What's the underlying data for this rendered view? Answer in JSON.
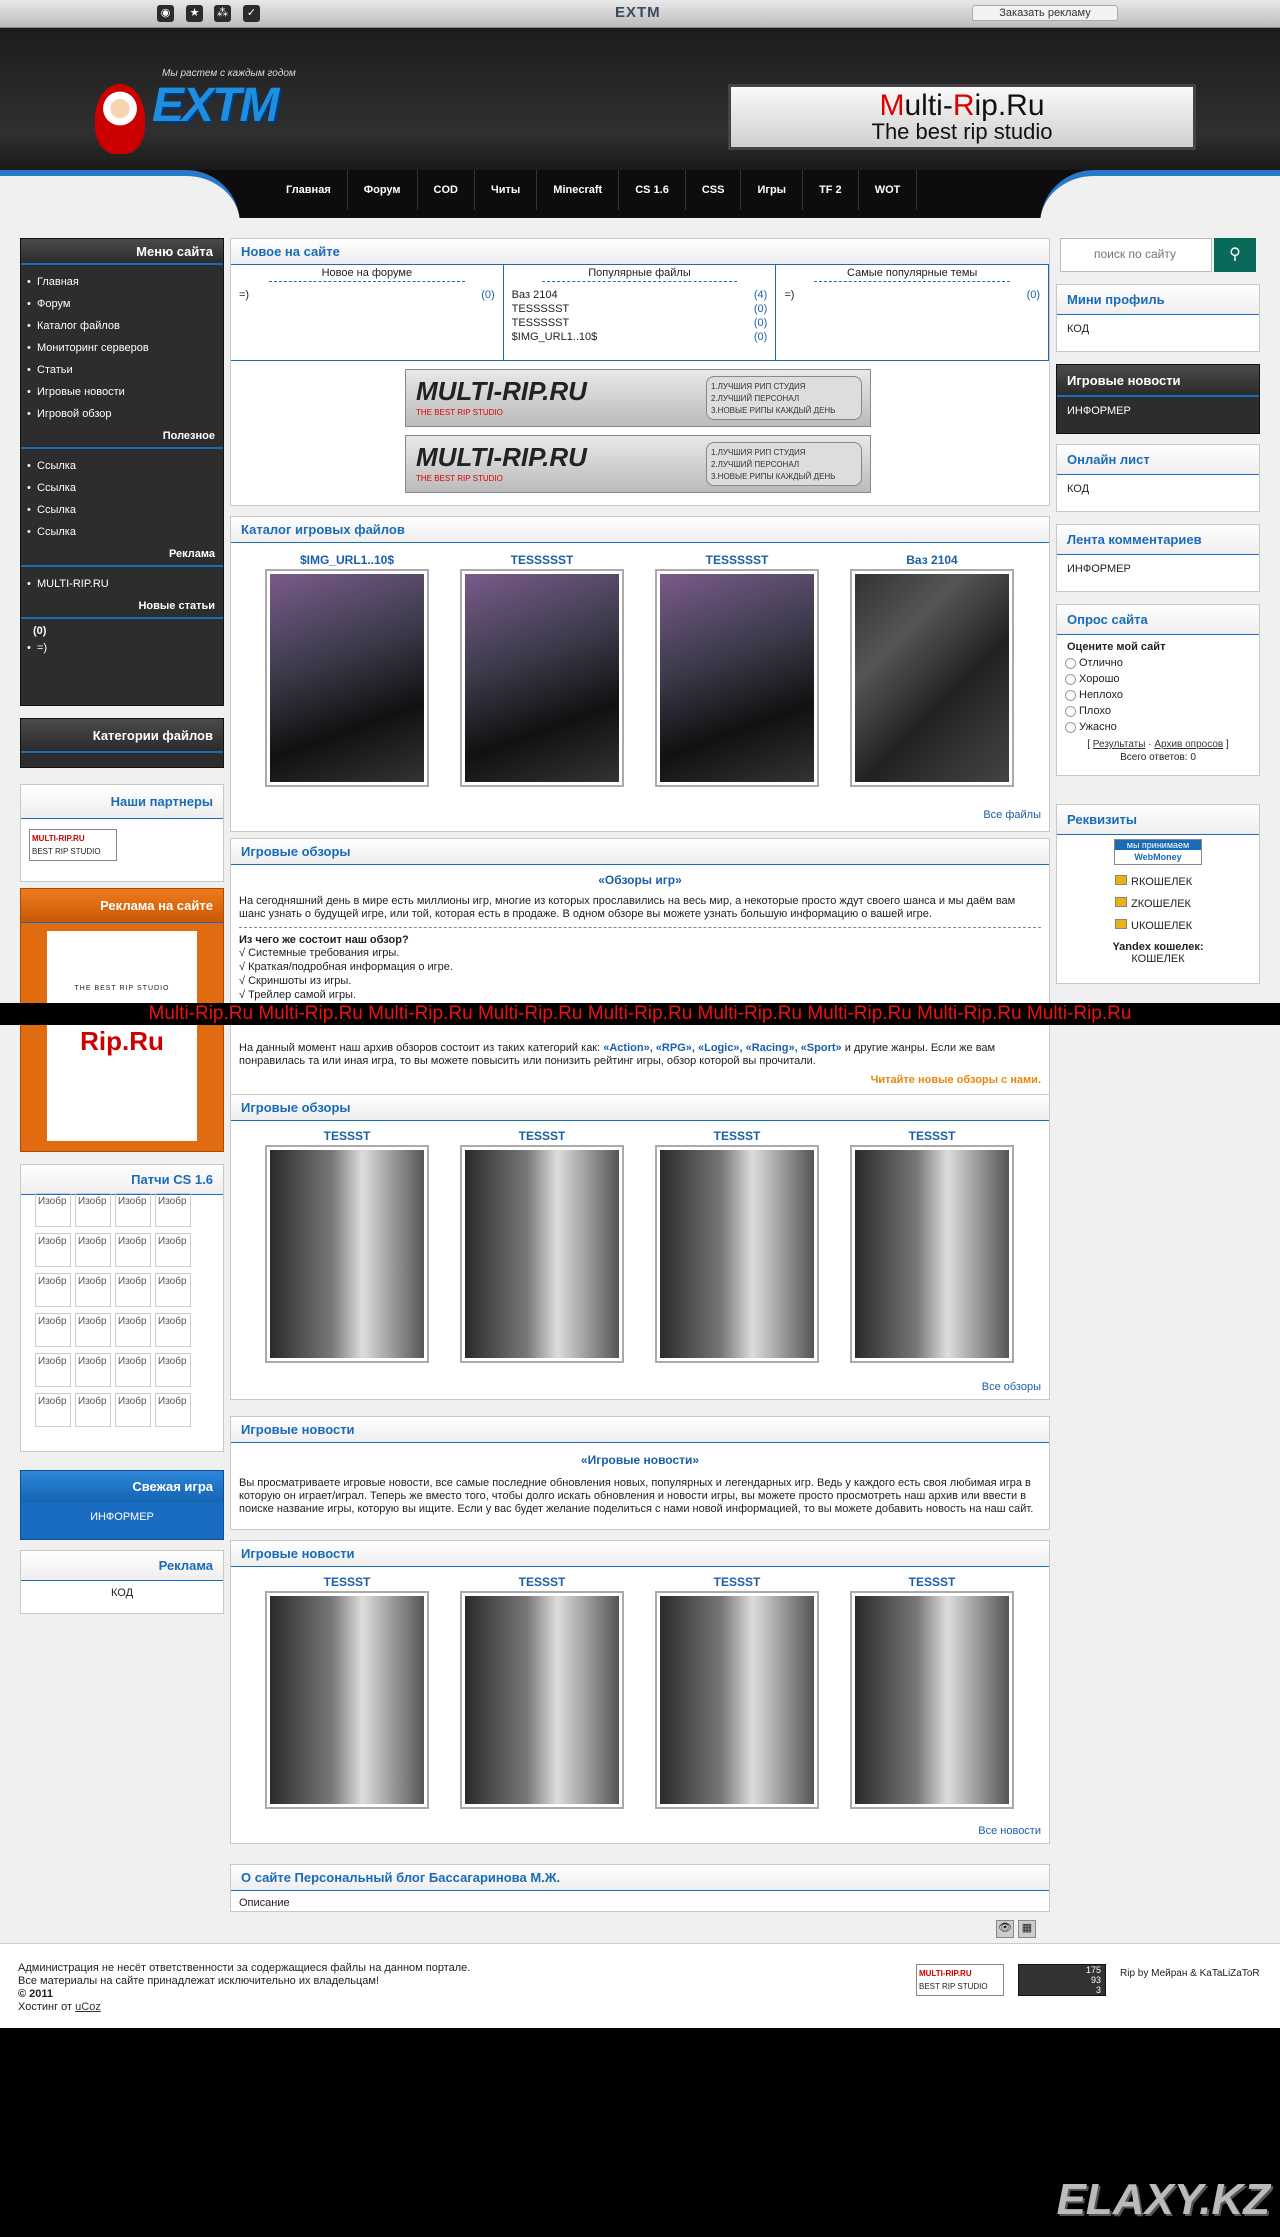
{
  "topbar": {
    "logo": "EXTM",
    "ad_order": "Заказать рекламу"
  },
  "header": {
    "slogan": "Мы растем с каждым годом",
    "logo": "EXTM",
    "banner_title_red": "M",
    "banner_title_rest": "ulti-",
    "banner_title_red2": "R",
    "banner_title_rest2": "ip.Ru",
    "banner_sub": "The best rip studio"
  },
  "nav": [
    "Главная",
    "Форум",
    "COD",
    "Читы",
    "Minecraft",
    "CS 1.6",
    "CSS",
    "Игры",
    "TF 2",
    "WOT"
  ],
  "left": {
    "menu_title": "Меню сайта",
    "menu": [
      "Главная",
      "Форум",
      "Каталог файлов",
      "Мониторинг серверов",
      "Статьи",
      "Игровые новости",
      "Игровой обзор"
    ],
    "useful_title": "Полезное",
    "useful": [
      "Ссылка",
      "Ссылка",
      "Ссылка",
      "Ссылка"
    ],
    "ads_title": "Реклама",
    "ads": [
      "MULTI-RIP.RU"
    ],
    "newart_title": "Новые статьи",
    "newart_count": "(0)",
    "newart": [
      "=)"
    ],
    "cats_title": "Категории файлов",
    "partners_title": "Наши партнеры",
    "partner_banner": "MULTI-RIP.RU",
    "partner_banner_sub": "BEST RIP STUDIO",
    "adsite_title": "Реклама на сайте",
    "adsite_banner": "Multi-Rip.Ru",
    "adsite_sub": "THE BEST RIP STUDIO",
    "patches_title": "Патчи CS 1.6",
    "patch_cell": "Изобр",
    "fresh_title": "Свежая игра",
    "fresh_body": "ИНФОРМЕР",
    "ad2_title": "Реклама",
    "ad2_body": "КОД"
  },
  "center": {
    "new_title": "Новое на сайте",
    "cols": [
      {
        "head": "Новое на форуме",
        "items": [
          {
            "t": "=)",
            "c": "(0)"
          }
        ]
      },
      {
        "head": "Популярные файлы",
        "items": [
          {
            "t": "Ваз 2104",
            "c": "(4)"
          },
          {
            "t": "TESSSSST",
            "c": "(0)"
          },
          {
            "t": "TESSSSST",
            "c": "(0)"
          },
          {
            "t": "$IMG_URL1..10$",
            "c": "(0)"
          }
        ]
      },
      {
        "head": "Самые популярные темы",
        "items": [
          {
            "t": "=)",
            "c": "(0)"
          }
        ]
      }
    ],
    "banner_text": "MULTI-RIP.RU",
    "banner_sub": "THE BEST RIP STUDIO",
    "banner_list": "1.ЛУЧШИЯ РИП СТУДИЯ\n2.ЛУЧШИЙ ПЕРСОНАЛ\n3.НОВЫЕ РИПЫ КАЖДЫЙ ДЕНЬ",
    "catalog_title": "Каталог игровых файлов",
    "catalog": [
      "$IMG_URL1..10$",
      "TESSSSST",
      "TESSSSST",
      "Ваз 2104"
    ],
    "catalog_link": "Все файлы",
    "reviews_title": "Игровые обзоры",
    "reviews_heading": "«Обзоры игр»",
    "reviews_p1": "На сегодняшний день в мире есть миллионы игр, многие из которых прославились на весь мир, а некоторые просто ждут своего шанса и мы даём вам шанс узнать о будущей игре, или той, которая есть в продаже. В одном обзоре вы можете узнать большую информацию о вашей игре.",
    "reviews_q": "Из чего же состоит наш обзор?",
    "reviews_list": [
      "√ Системные требования игры.",
      "√ Краткая/подробная информация о игре.",
      "√ Скриншоты из игры.",
      "√ Трейлер самой игры."
    ],
    "reviews_p2_a": "На данный момент наш архив обзоров состоит из таких категорий как: ",
    "reviews_cats": "«Action», «RPG», «Logic», «Racing», «Sport»",
    "reviews_p2_b": " и другие жанры. Если же вам понравилась та или иная игра, то вы можете повысить или понизить рейтинг игры, обзор которой вы прочитали.",
    "reviews_more": "Читайте новые обзоры с нами.",
    "reviews2_title": "Игровые обзоры",
    "reviews2": [
      "TESSST",
      "TESSST",
      "TESSST",
      "TESSST"
    ],
    "reviews2_link": "Все обзоры",
    "news_title": "Игровые новости",
    "news_heading": "«Игровые новости»",
    "news_p": "Вы просматриваете игровые новости, все самые последние обновления новых, популярных и легендарных игр. Ведь у каждого есть своя любимая игра в которую он играет/играл. Теперь же вместо того, чтобы долго искать обновления и новости игры, вы можете просто просмотреть наш архив или ввести в поиске название игры, которую вы ищите. Если у вас будет желание поделиться с нами новой информацией, то вы можете добавить новость на наш сайт.",
    "news2_title": "Игровые новости",
    "news2": [
      "TESSST",
      "TESSST",
      "TESSST",
      "TESSST"
    ],
    "news2_link": "Все новости",
    "about_title": "О сайте Персональный блог Бассагаринова М.Ж.",
    "about_body": "Описание"
  },
  "redbar": "Multi-Rip.Ru Multi-Rip.Ru Multi-Rip.Ru Multi-Rip.Ru Multi-Rip.Ru Multi-Rip.Ru Multi-Rip.Ru Multi-Rip.Ru Multi-Rip.Ru",
  "right": {
    "search_placeholder": "поиск по сайту",
    "mini_title": "Мини профиль",
    "mini_body": "КОД",
    "gnews_title": "Игровые новости",
    "gnews_body": "ИНФОРМЕР",
    "online_title": "Онлайн лист",
    "online_body": "КОД",
    "comments_title": "Лента комментариев",
    "comments_body": "ИНФОРМЕР",
    "poll_title": "Опрос сайта",
    "poll_q": "Оцените мой сайт",
    "poll_opts": [
      "Отлично",
      "Хорошо",
      "Неплохо",
      "Плохо",
      "Ужасно"
    ],
    "poll_results": "Результаты",
    "poll_archive": "Архив опросов",
    "poll_total": "Всего ответов: 0",
    "req_title": "Реквизиты",
    "req_we_accept": "мы принимаем",
    "req_wm": "WebMoney",
    "wallets": [
      "RКОШЕЛЕК",
      "ZКОШЕЛЕК",
      "UКОШЕЛЕК"
    ],
    "yandex": "Yandex кошелек:",
    "yandex_val": "КОШЕЛЕК"
  },
  "footer": {
    "l1": "Администрация не несёт ответственности за содержащиеся файлы на данном портале.",
    "l2": "Все материалы на сайте принадлежат исключительно их владельцам!",
    "l3": "© 2011",
    "l4a": "Хостинг от ",
    "l4b": "uCoz",
    "credit": "Rip by Мейран & KaTaLiZaToR",
    "counter": [
      "175",
      "93",
      "3"
    ]
  },
  "watermark": "ELAXY.KZ"
}
